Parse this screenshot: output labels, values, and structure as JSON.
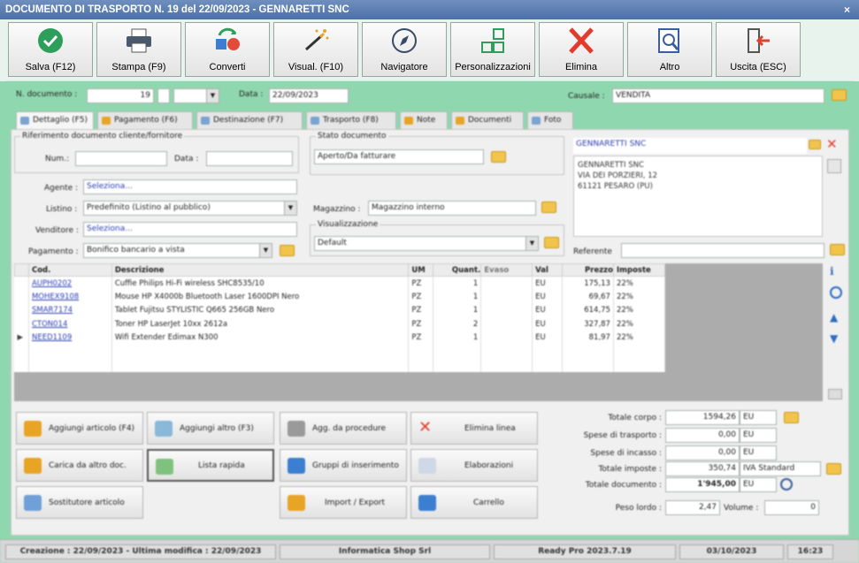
{
  "window": {
    "title": "DOCUMENTO DI TRASPORTO N. 19 del 22/09/2023 - GENNARETTI SNC",
    "close": "×"
  },
  "toolbar": {
    "save": "Salva (F12)",
    "print": "Stampa (F9)",
    "convert": "Converti",
    "view": "Visual. (F10)",
    "navigator": "Navigatore",
    "custom": "Personalizzazioni",
    "delete": "Elimina",
    "other": "Altro",
    "exit": "Uscita (ESC)"
  },
  "header": {
    "num_label": "N. documento :",
    "num_value": "19",
    "date_label": "Data :",
    "date_value": "22/09/2023",
    "causale_label": "Causale :",
    "causale_value": "VENDITA"
  },
  "tabs": [
    "Dettaglio (F5)",
    "Pagamento (F6)",
    "Destinazione (F7)",
    "Trasporto (F8)",
    "Note",
    "Documenti",
    "Foto"
  ],
  "ref": {
    "title": "Riferimento documento cliente/fornitore",
    "num_label": "Num.:",
    "date_label": "Data :"
  },
  "fields": {
    "agente_label": "Agente :",
    "agente_value": "Seleziona...",
    "listino_label": "Listino :",
    "listino_value": "Predefinito (Listino al pubblico)",
    "venditore_label": "Venditore :",
    "venditore_value": "Seleziona...",
    "pagamento_label": "Pagamento :",
    "pagamento_value": "Bonifico bancario a vista"
  },
  "stato": {
    "title": "Stato documento",
    "value": "Aperto/Da fatturare"
  },
  "magazzino": {
    "label": "Magazzino :",
    "value": "Magazzino interno"
  },
  "visualizzazione": {
    "title": "Visualizzazione",
    "value": "Default"
  },
  "client": {
    "name": "GENNARETTI SNC",
    "address_line1": "GENNARETTI SNC",
    "address_line2": "VIA DEI PORZIERI, 12",
    "address_line3": "61121 PESARO (PU)",
    "referente_label": "Referente"
  },
  "grid": {
    "headers": [
      "Cod.",
      "Descrizione",
      "UM",
      "Quant.",
      "Evaso",
      "Val",
      "Prezzo",
      "Imposte"
    ],
    "rows": [
      {
        "cod": "AUPH0202",
        "desc": "Cuffie Philips Hi-Fi wireless SHC8535/10",
        "um": "PZ",
        "qty": "1",
        "val": "EU",
        "price": "175,13",
        "tax": "22%"
      },
      {
        "cod": "MOHEX9108",
        "desc": "Mouse HP X4000b Bluetooth Laser 1600DPI Nero",
        "um": "PZ",
        "qty": "1",
        "val": "EU",
        "price": "69,67",
        "tax": "22%"
      },
      {
        "cod": "SMAR7174",
        "desc": "Tablet Fujitsu STYLISTIC Q665 256GB Nero",
        "um": "PZ",
        "qty": "1",
        "val": "EU",
        "price": "614,75",
        "tax": "22%"
      },
      {
        "cod": "CTON014",
        "desc": "Toner HP LaserJet 10xx 2612a",
        "um": "PZ",
        "qty": "2",
        "val": "EU",
        "price": "327,87",
        "tax": "22%"
      },
      {
        "cod": "NEED1109",
        "desc": "Wifi Extender Edimax N300",
        "um": "PZ",
        "qty": "1",
        "val": "EU",
        "price": "81,97",
        "tax": "22%"
      }
    ]
  },
  "buttons": {
    "add_article": "Aggiungi articolo (F4)",
    "add_other": "Aggiungi altro (F3)",
    "agg_procedure": "Agg. da procedure",
    "delete_line": "Elimina linea",
    "load_other": "Carica da altro doc.",
    "quick_list": "Lista rapida",
    "insert_groups": "Gruppi di inserimento",
    "elaborations": "Elaborazioni",
    "substitute": "Sostitutore articolo",
    "import_export": "Import / Export",
    "cart": "Carrello"
  },
  "totals": {
    "corpo_label": "Totale corpo :",
    "corpo_value": "1594,26",
    "trasporto_label": "Spese di trasporto :",
    "trasporto_value": "0,00",
    "incasso_label": "Spese di incasso :",
    "incasso_value": "0,00",
    "imposte_label": "Totale imposte :",
    "imposte_value": "350,74",
    "iva_value": "IVA Standard",
    "documento_label": "Totale documento :",
    "documento_value": "1'945,00",
    "currency": "EU",
    "peso_label": "Peso lordo :",
    "peso_value": "2,47",
    "volume_label": "Volume :",
    "volume_value": "0"
  },
  "status": {
    "created": "Creazione : 22/09/2023 - Ultima modifica : 22/09/2023",
    "company": "Informatica Shop Srl",
    "version": "Ready Pro 2023.7.19",
    "date": "03/10/2023",
    "time": "16:23"
  },
  "colors": {
    "titlebar": "#4d70a4",
    "background": "#8fd7ae",
    "save": "#2e9e5b",
    "delete": "#e23b2e"
  }
}
